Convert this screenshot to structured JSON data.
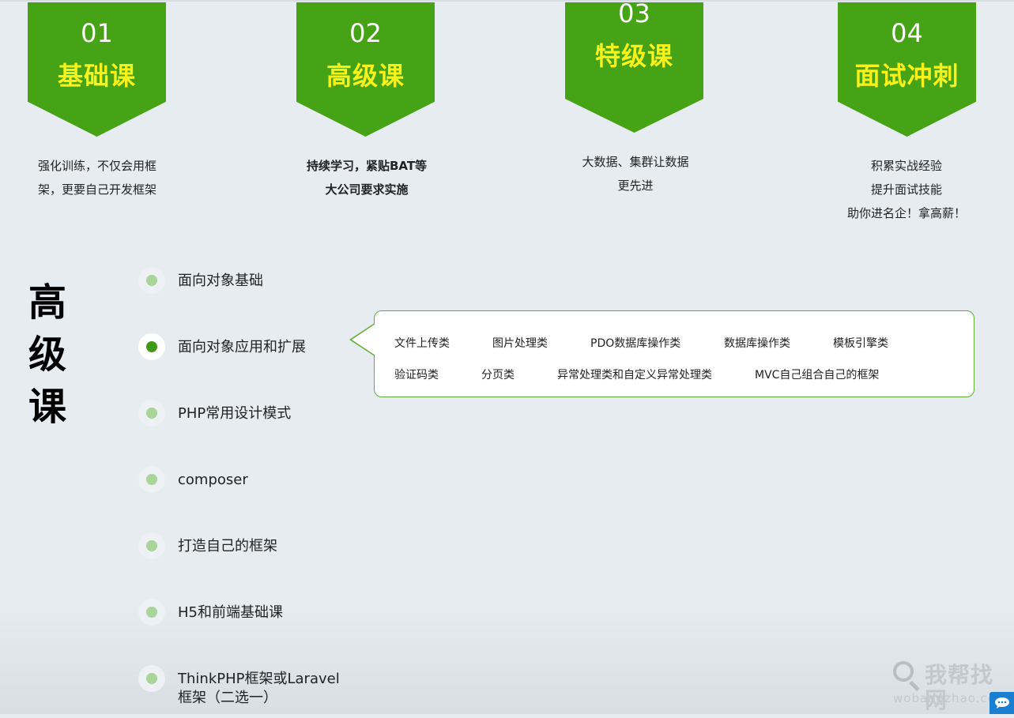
{
  "courses": [
    {
      "num": "01",
      "name": "基础课",
      "desc": [
        "强化训练，不仅会用框",
        "架，更要自己开发框架"
      ],
      "desc_bold": false
    },
    {
      "num": "02",
      "name": "高级课",
      "desc": [
        "持续学习，紧贴BAT等",
        "大公司要求实施"
      ],
      "desc_bold": true
    },
    {
      "num": "03",
      "name": "特级课",
      "desc": [
        "大数据、集群让数据",
        "更先进"
      ],
      "desc_bold": false
    },
    {
      "num": "04",
      "name": "面试冲刺",
      "desc": [
        "积累实战经验",
        "提升面试技能",
        "助你进名企！拿高薪！"
      ],
      "desc_bold": false
    }
  ],
  "section_title": [
    "高",
    "级",
    "课"
  ],
  "topics": [
    {
      "label": "面向对象基础"
    },
    {
      "label": "面向对象应用和扩展"
    },
    {
      "label": "PHP常用设计模式"
    },
    {
      "label": "composer"
    },
    {
      "label": "打造自己的框架"
    },
    {
      "label": "H5和前端基础课"
    },
    {
      "label": "ThinkPHP框架或Laravel框架（二选一）"
    }
  ],
  "active_topic": "面向对象应用和扩展",
  "detail_items": [
    [
      "文件上传类",
      "图片处理类",
      "PDO数据库操作类",
      "数据库操作类",
      "模板引擎类"
    ],
    [
      "验证码类",
      "分页类",
      "异常处理类和自定义异常处理类",
      "MVC自己组合自己的框架"
    ]
  ],
  "watermark": {
    "name": "我帮找网",
    "url": "wobangzhao.com"
  },
  "icons": {
    "search": "magnifier-icon",
    "chat": "chat-icon"
  },
  "colors": {
    "accent": "#46a315",
    "accent_text": "#f9f11c",
    "dot_inactive": "#a9d49a",
    "dot_active": "#3d9a12"
  }
}
